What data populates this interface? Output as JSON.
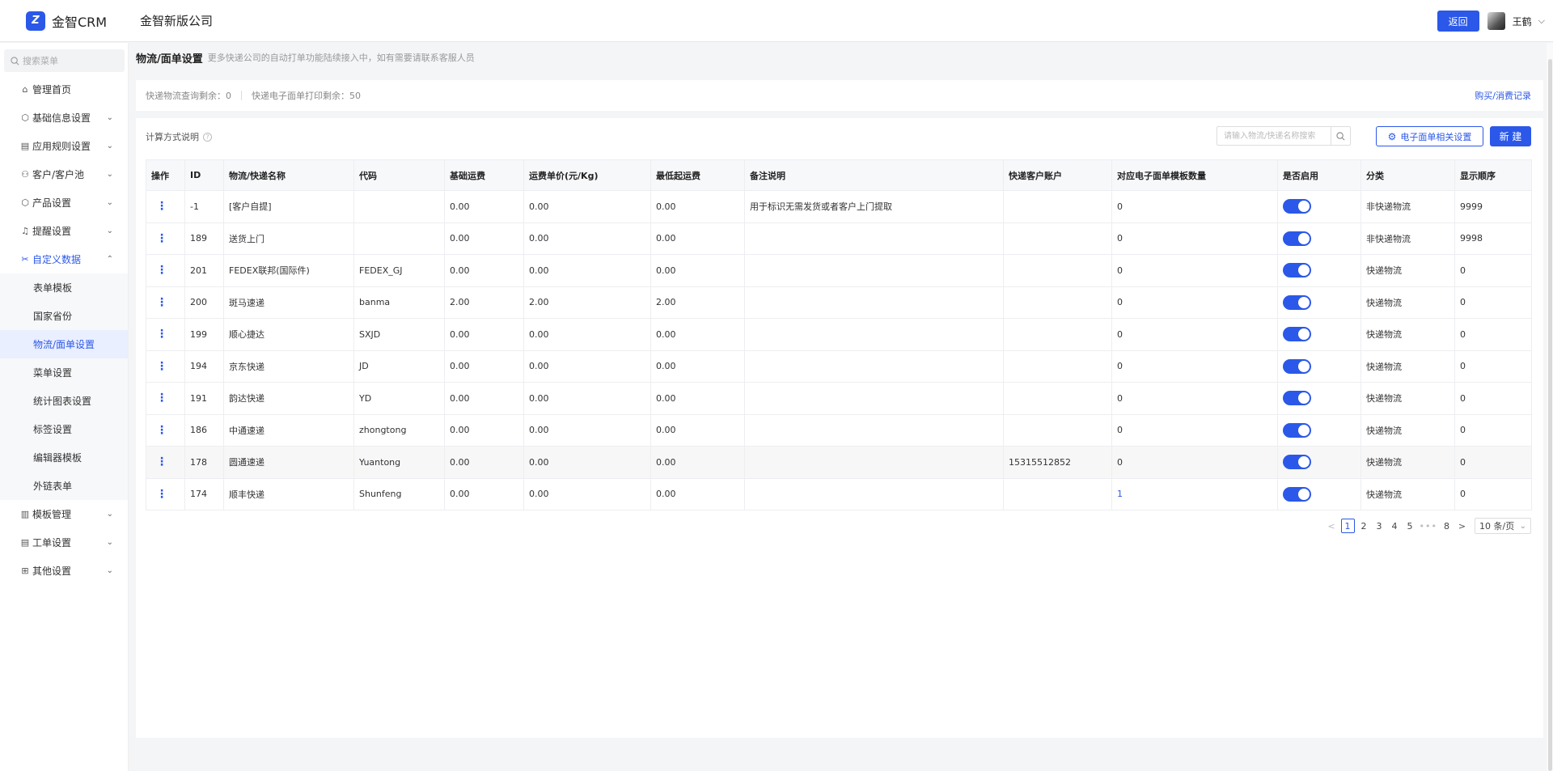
{
  "header": {
    "logo_text": "金智CRM",
    "company": "金智新版公司",
    "back_label": "返回",
    "user_name": "王鹤"
  },
  "sidebar": {
    "search_placeholder": "搜索菜单",
    "items": [
      {
        "label": "管理首页",
        "icon": "home-icon"
      },
      {
        "label": "基础信息设置",
        "icon": "cube-icon"
      },
      {
        "label": "应用规则设置",
        "icon": "doc-icon"
      },
      {
        "label": "客户/客户池",
        "icon": "users-icon"
      },
      {
        "label": "产品设置",
        "icon": "box-icon"
      },
      {
        "label": "提醒设置",
        "icon": "bell-icon"
      },
      {
        "label": "自定义数据",
        "icon": "tools-icon"
      }
    ],
    "submenu": [
      "表单模板",
      "国家省份",
      "物流/面单设置",
      "菜单设置",
      "统计图表设置",
      "标签设置",
      "编辑器模板",
      "外链表单"
    ],
    "bottom_items": [
      {
        "label": "模板管理",
        "icon": "layout-icon"
      },
      {
        "label": "工单设置",
        "icon": "ticket-icon"
      },
      {
        "label": "其他设置",
        "icon": "grid-icon"
      }
    ]
  },
  "page": {
    "title": "物流/面单设置",
    "desc": "更多快递公司的自动打单功能陆续接入中，如有需要请联系客服人员"
  },
  "info": {
    "query_label": "快递物流查询剩余：",
    "query_value": "0",
    "print_label": "快递电子面单打印剩余：",
    "print_value": "50",
    "purchase_link": "购买/消费记录"
  },
  "toolbar": {
    "calc_label": "计算方式说明",
    "search_placeholder": "请输入物流/快递名称搜索",
    "eface_label": "电子面单相关设置",
    "new_label": "新 建"
  },
  "table": {
    "headers": [
      "操作",
      "ID",
      "物流/快递名称",
      "代码",
      "基础运费",
      "运费单价(元/Kg)",
      "最低起运费",
      "备注说明",
      "快递客户账户",
      "对应电子面单模板数量",
      "是否启用",
      "分类",
      "显示顺序"
    ],
    "rows": [
      {
        "id": "-1",
        "name": "[客户自提]",
        "code": "",
        "base": "0.00",
        "unit": "0.00",
        "min": "0.00",
        "remark": "用于标识无需发货或者客户上门提取",
        "account": "",
        "templates": "0",
        "enabled": true,
        "category": "非快递物流",
        "order": "9999"
      },
      {
        "id": "189",
        "name": "送货上门",
        "code": "",
        "base": "0.00",
        "unit": "0.00",
        "min": "0.00",
        "remark": "",
        "account": "",
        "templates": "0",
        "enabled": true,
        "category": "非快递物流",
        "order": "9998"
      },
      {
        "id": "201",
        "name": "FEDEX联邦(国际件)",
        "code": "FEDEX_GJ",
        "base": "0.00",
        "unit": "0.00",
        "min": "0.00",
        "remark": "",
        "account": "",
        "templates": "0",
        "enabled": true,
        "category": "快递物流",
        "order": "0"
      },
      {
        "id": "200",
        "name": "斑马速递",
        "code": "banma",
        "base": "2.00",
        "unit": "2.00",
        "min": "2.00",
        "remark": "",
        "account": "",
        "templates": "0",
        "enabled": true,
        "category": "快递物流",
        "order": "0"
      },
      {
        "id": "199",
        "name": "顺心捷达",
        "code": "SXJD",
        "base": "0.00",
        "unit": "0.00",
        "min": "0.00",
        "remark": "",
        "account": "",
        "templates": "0",
        "enabled": true,
        "category": "快递物流",
        "order": "0"
      },
      {
        "id": "194",
        "name": "京东快递",
        "code": "JD",
        "base": "0.00",
        "unit": "0.00",
        "min": "0.00",
        "remark": "",
        "account": "",
        "templates": "0",
        "enabled": true,
        "category": "快递物流",
        "order": "0"
      },
      {
        "id": "191",
        "name": "韵达快递",
        "code": "YD",
        "base": "0.00",
        "unit": "0.00",
        "min": "0.00",
        "remark": "",
        "account": "",
        "templates": "0",
        "enabled": true,
        "category": "快递物流",
        "order": "0"
      },
      {
        "id": "186",
        "name": "中通速递",
        "code": "zhongtong",
        "base": "0.00",
        "unit": "0.00",
        "min": "0.00",
        "remark": "",
        "account": "",
        "templates": "0",
        "enabled": true,
        "category": "快递物流",
        "order": "0"
      },
      {
        "id": "178",
        "name": "圆通速递",
        "code": "Yuantong",
        "base": "0.00",
        "unit": "0.00",
        "min": "0.00",
        "remark": "",
        "account": "15315512852",
        "templates": "0",
        "enabled": true,
        "category": "快递物流",
        "order": "0"
      },
      {
        "id": "174",
        "name": "顺丰快递",
        "code": "Shunfeng",
        "base": "0.00",
        "unit": "0.00",
        "min": "0.00",
        "remark": "",
        "account": "",
        "templates": "1",
        "enabled": true,
        "category": "快递物流",
        "order": "0"
      }
    ]
  },
  "pagination": {
    "pages": [
      "1",
      "2",
      "3",
      "4",
      "5"
    ],
    "ellipsis": "•••",
    "last": "8",
    "current": "1",
    "page_size": "10 条/页"
  },
  "colors": {
    "primary": "#2b58e8"
  }
}
